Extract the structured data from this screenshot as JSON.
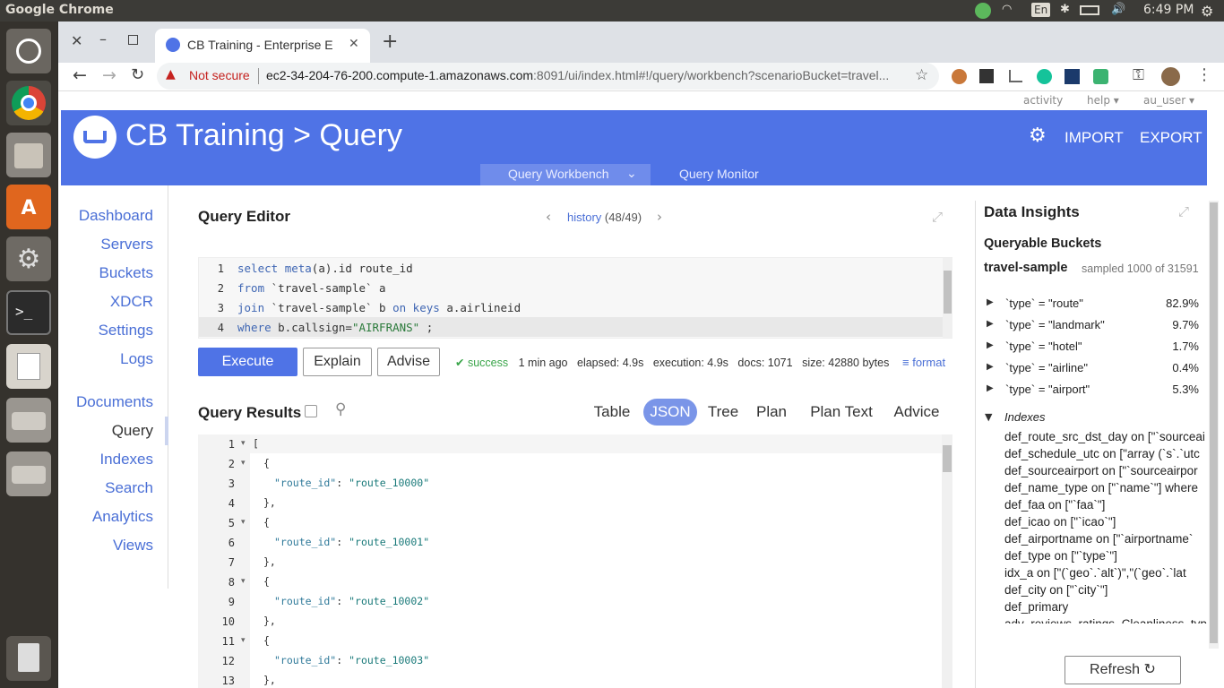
{
  "os": {
    "app_title": "Google Chrome",
    "clock": "6:49 PM",
    "kbd": "En"
  },
  "browser": {
    "tab_title": "CB Training - Enterprise E",
    "not_secure": "Not secure",
    "url_host": "ec2-34-204-76-200.compute-1.amazonaws.com",
    "url_rest": ":8091/ui/index.html#!/query/workbench?scenarioBucket=travel..."
  },
  "topmenu": {
    "activity": "activity",
    "help": "help",
    "user": "au_user"
  },
  "header": {
    "title": "CB Training > Query",
    "import": "IMPORT",
    "export": "EXPORT"
  },
  "subnav": {
    "workbench": "Query Workbench",
    "monitor": "Query Monitor"
  },
  "sidebar": {
    "items": [
      "Dashboard",
      "Servers",
      "Buckets",
      "XDCR",
      "Settings",
      "Logs",
      "Documents",
      "Query",
      "Indexes",
      "Search",
      "Analytics",
      "Views"
    ]
  },
  "editor": {
    "title": "Query Editor",
    "history_label": "history",
    "history_count": "(48/49)",
    "line_numbers": [
      "1",
      "2",
      "3",
      "4"
    ],
    "lines": [
      {
        "a": "select ",
        "b": "meta",
        "c": "(a).id route_id"
      },
      {
        "a": "from ",
        "b": "`travel-sample`",
        "c": " a"
      },
      {
        "a": "join ",
        "b": "`travel-sample`",
        "c": " b ",
        "d": "on keys",
        "e": " a.airlineid"
      },
      {
        "a": "where ",
        "b": "b.callsign=",
        "c": "\"AIRFRANS\"",
        "d": " ;"
      }
    ],
    "execute": "Execute",
    "explain": "Explain",
    "advise": "Advise",
    "status": "success",
    "ago": "1 min ago",
    "elapsed": "elapsed: 4.9s",
    "execution": "execution: 4.9s",
    "docs": "docs: 1071",
    "size": "size: 42880 bytes",
    "format": "format"
  },
  "results": {
    "title": "Query Results",
    "tabs": [
      "Table",
      "JSON",
      "Tree",
      "Plan",
      "Plan Text",
      "Advice"
    ],
    "line_numbers": [
      "1",
      "2",
      "3",
      "4",
      "5",
      "6",
      "7",
      "8",
      "9",
      "10",
      "11",
      "12",
      "13"
    ],
    "lines": [
      "[",
      "{",
      "\"route_id\": \"route_10000\"",
      "},",
      "{",
      "\"route_id\": \"route_10001\"",
      "},",
      "{",
      "\"route_id\": \"route_10002\"",
      "},",
      "{",
      "\"route_id\": \"route_10003\"",
      "},"
    ],
    "keys": [
      "\"route_id\"",
      "\"route_id\"",
      "\"route_id\"",
      "\"route_id\""
    ],
    "vals": [
      "\"route_10000\"",
      "\"route_10001\"",
      "\"route_10002\"",
      "\"route_10003\""
    ]
  },
  "insights": {
    "title": "Data Insights",
    "queryable": "Queryable Buckets",
    "bucket": "travel-sample",
    "sampled": "sampled 1000 of 31591",
    "types": [
      {
        "label": "`type` = \"route\"",
        "pct": "82.9%"
      },
      {
        "label": "`type` = \"landmark\"",
        "pct": "9.7%"
      },
      {
        "label": "`type` = \"hotel\"",
        "pct": "1.7%"
      },
      {
        "label": "`type` = \"airline\"",
        "pct": "0.4%"
      },
      {
        "label": "`type` = \"airport\"",
        "pct": "5.3%"
      }
    ],
    "indexes_label": "Indexes",
    "indexes": [
      "def_route_src_dst_day on [\"`sourceai",
      "def_schedule_utc on [\"array (`s`.`utc",
      "def_sourceairport on [\"`sourceairpor",
      "def_name_type on [\"`name`\"] where",
      "def_faa on [\"`faa`\"]",
      "def_icao on [\"`icao`\"]",
      "def_airportname on [\"`airportname`",
      "def_type on [\"`type`\"]",
      "idx_a on [\"(`geo`.`alt`)\",\"(`geo`.`lat",
      "def_city on [\"`city`\"]",
      "def_primary",
      "adv_reviews_ratings_Cleanliness_type"
    ],
    "refresh": "Refresh"
  }
}
